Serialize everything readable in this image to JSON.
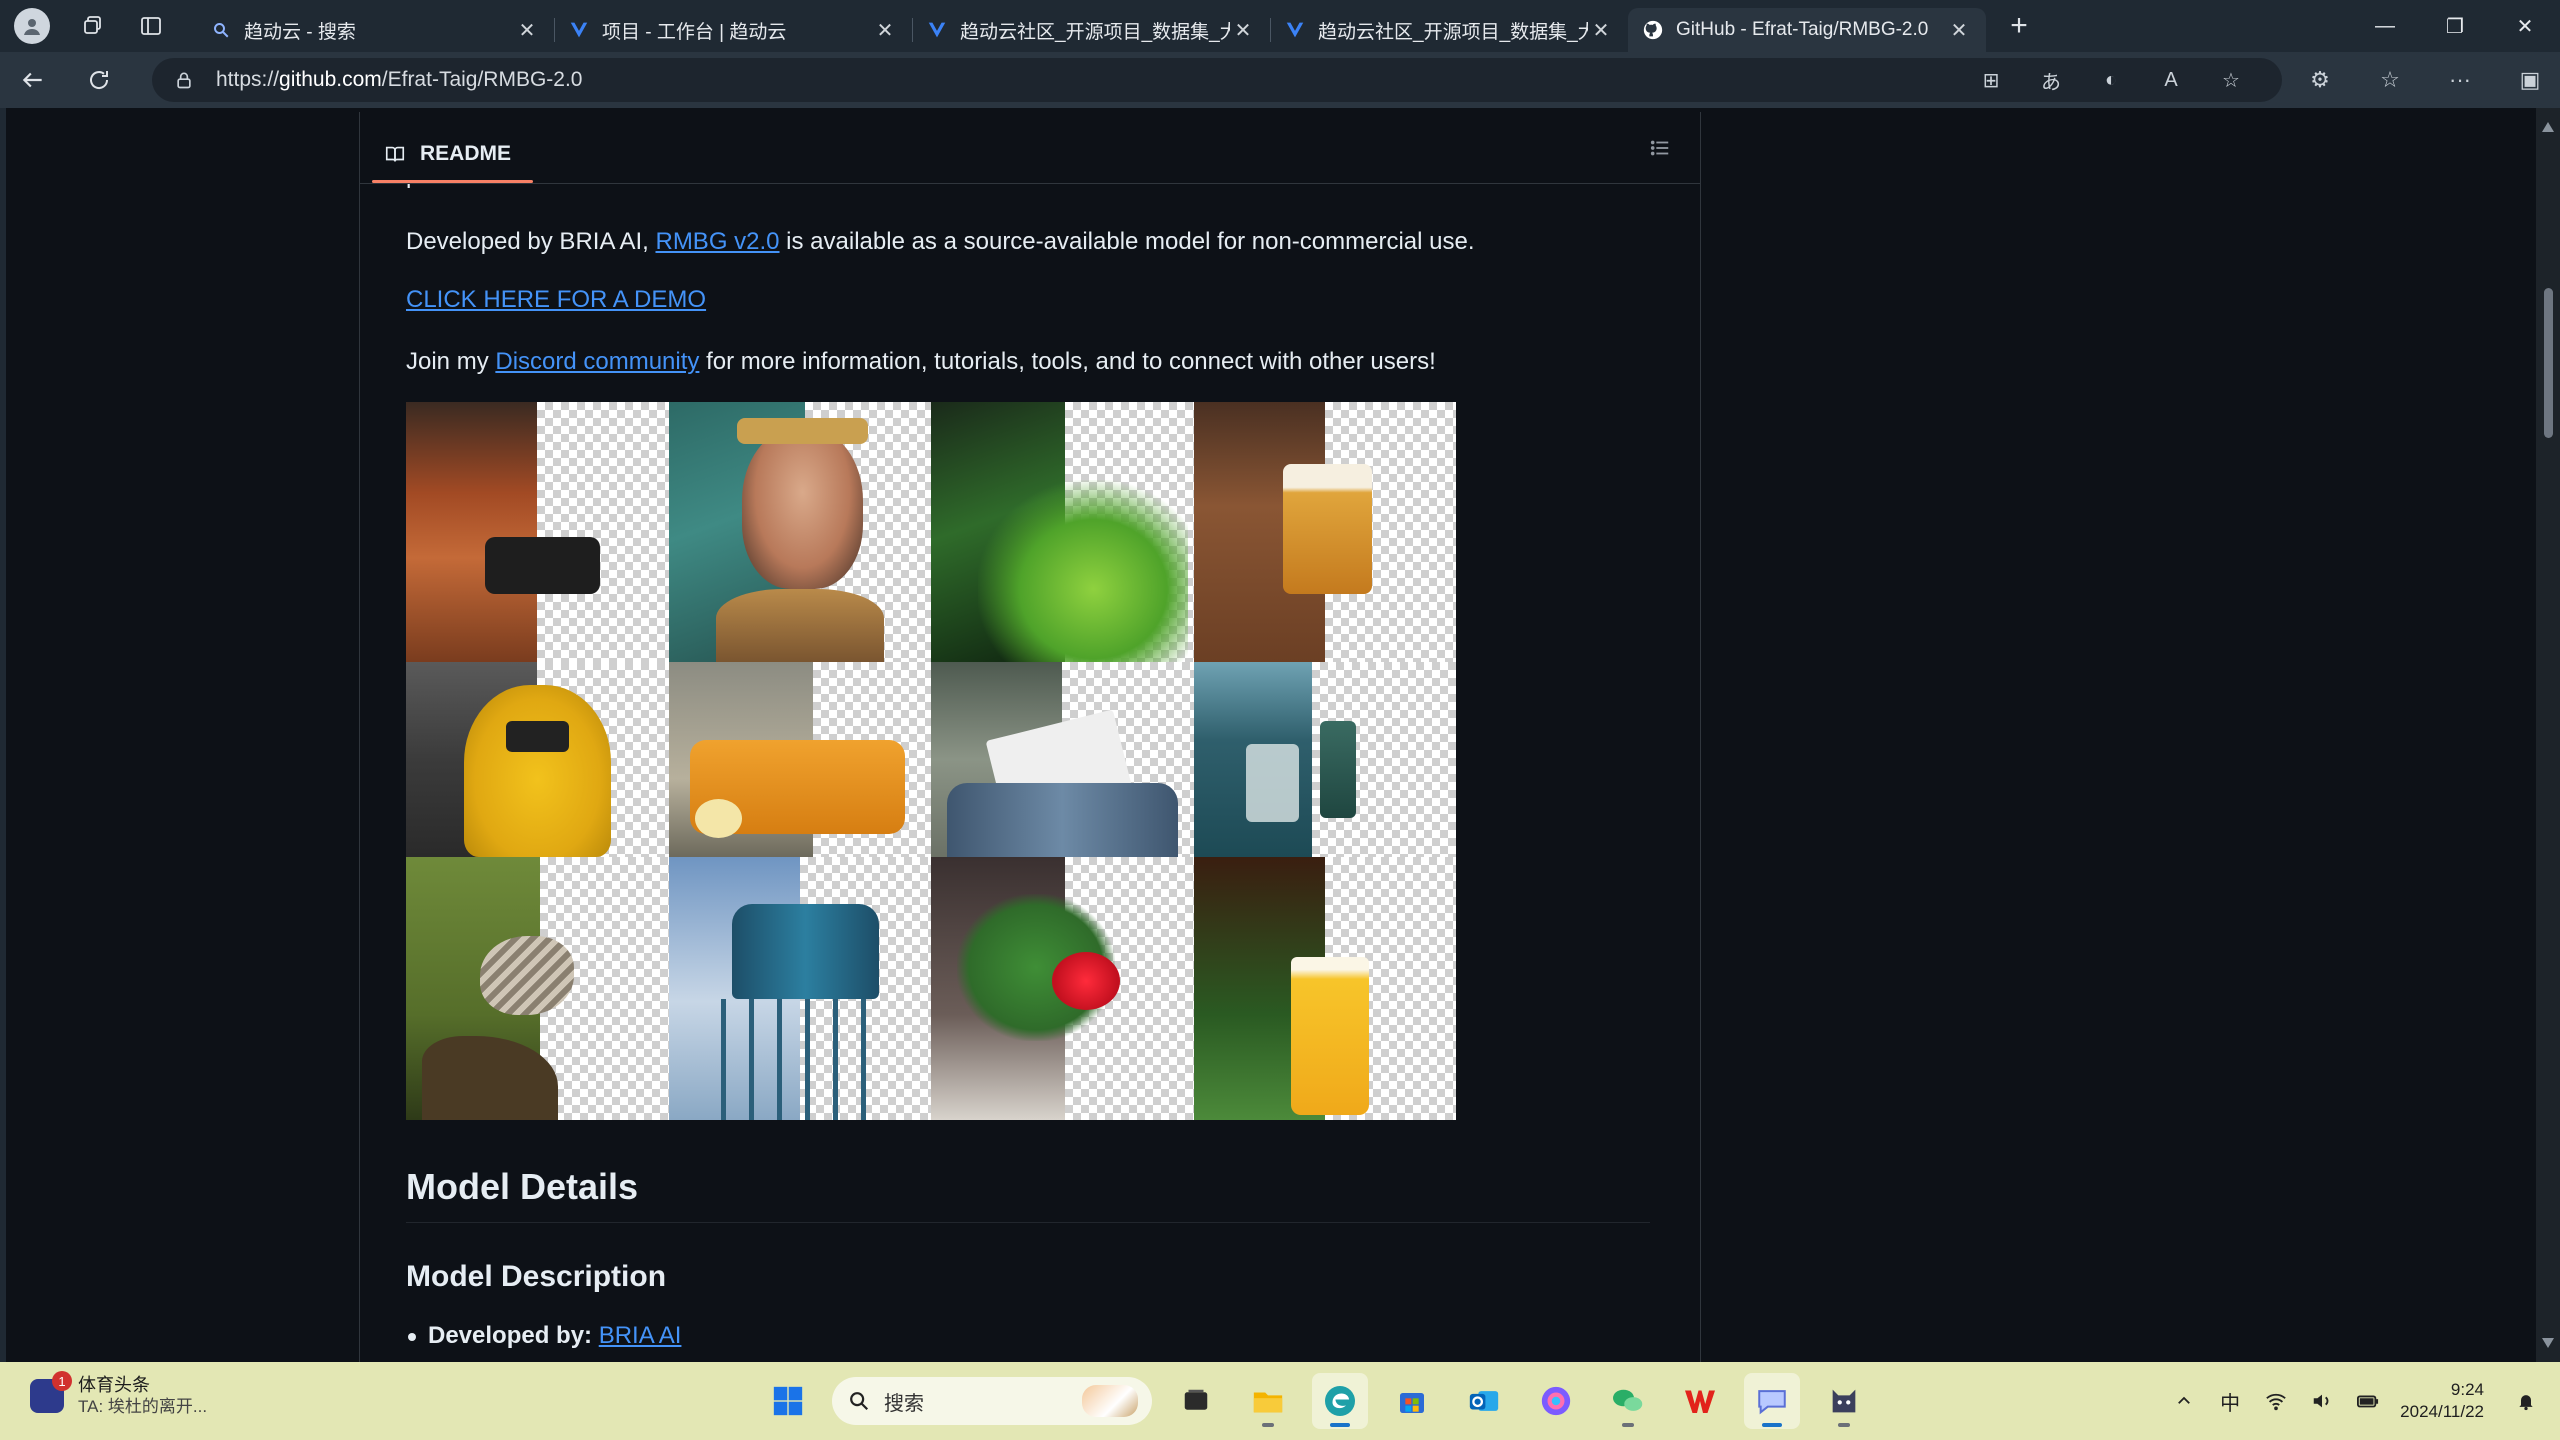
{
  "browser": {
    "tabs": [
      {
        "title": "趋动云 - 搜索",
        "icon": "search-icon",
        "active": false
      },
      {
        "title": "项目 - 工作台 | 趋动云",
        "icon": "virtaicloud-icon",
        "active": false
      },
      {
        "title": "趋动云社区_开源项目_数据集_大模",
        "icon": "virtaicloud-icon",
        "active": false
      },
      {
        "title": "趋动云社区_开源项目_数据集_大模",
        "icon": "virtaicloud-icon",
        "active": false
      },
      {
        "title": "GitHub - Efrat-Taig/RMBG-2.0",
        "icon": "github-icon",
        "active": true
      }
    ],
    "address": {
      "prefix": "https://",
      "domain": "github.com",
      "path": "/Efrat-Taig/RMBG-2.0"
    }
  },
  "readme": {
    "tab_label": "README",
    "cut_text": "paramount.",
    "developed_prefix": "Developed by BRIA AI, ",
    "developed_link": "RMBG v2.0",
    "developed_suffix": " is available as a source-available model for non-commercial use.",
    "demo_link": "CLICK HERE FOR A DEMO",
    "join_prefix": "Join my ",
    "join_link": "Discord community",
    "join_suffix": " for more information, tutorials, tools, and to connect with other users!",
    "h2": "Model Details",
    "h3": "Model Description",
    "li_label": "Developed by:",
    "li_link": "BRIA AI"
  },
  "taskbar": {
    "news_title": "体育头条",
    "news_sub": "TA: 埃杜的离开...",
    "news_badge": "1",
    "search_placeholder": "搜索",
    "ime": "中",
    "time": "9:24",
    "date": "2024/11/22"
  },
  "colors": {
    "page_bg": "#0d1117",
    "link": "#4493f8",
    "tab_underline": "#f78166",
    "taskbar_bg": "#e3e7b4"
  }
}
